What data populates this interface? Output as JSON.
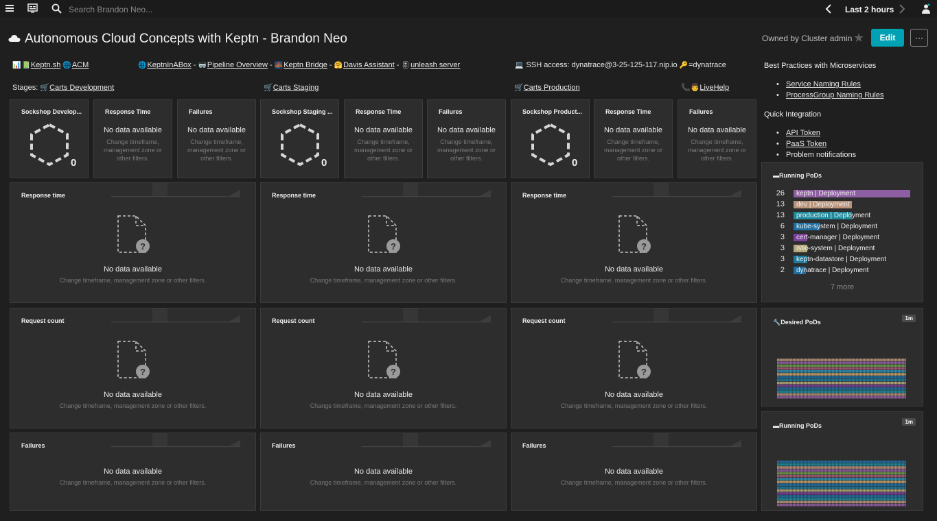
{
  "topbar": {
    "search_placeholder": "Search Brandon Neo...",
    "timeframe": "Last 2 hours"
  },
  "header": {
    "title": "Autonomous Cloud Concepts with Keptn - Brandon Neo",
    "owned_by": "Owned by Cluster admin",
    "edit_label": "Edit",
    "more_label": "···"
  },
  "links": {
    "keptn_sh": "Keptn.sh",
    "acm": "ACM",
    "keptninabox": "KeptnInABox",
    "pipeline_overview": "Pipeline Overview",
    "keptn_bridge": "Keptn Bridge",
    "davis_assistant": "Davis Assistant",
    "unleash_server": "unleash server",
    "ssh_access": "SSH access: dynatrace@3-25-125-117.nip.io",
    "ssh_pass": "=dynatrace",
    "dash": "-"
  },
  "stages": {
    "label": "Stages:",
    "dev": "Carts Development",
    "staging": "Carts Staging",
    "prod": "Carts Production",
    "livehelp": "LiveHelp"
  },
  "right_panel": {
    "bp_title": "Best Practices with Microservices",
    "bp_items": [
      "Service Naming Rules",
      "ProcessGroup Naming Rules"
    ],
    "qi_title": "Quick Integration",
    "qi_items": [
      "API Token",
      "PaaS Token",
      "Problem notifications"
    ]
  },
  "small_tiles": {
    "dev_app": "Sockshop Develop...",
    "staging_app": "Sockshop Staging ...",
    "prod_app": "Sockshop Product...",
    "response_time": "Response Time",
    "failures": "Failures",
    "no_data": "No data available",
    "no_data_sub": "Change timeframe, management zone or other filters.",
    "hex_count": "0"
  },
  "big_tiles": {
    "response_time": "Response time",
    "request_count": "Request count",
    "failures": "Failures",
    "no_data": "No data available",
    "no_data_sub": "Change timeframe, management zone or other filters."
  },
  "running_pods": {
    "title": "Running PoDs",
    "rows": [
      {
        "count": "26",
        "label": "keptn | Deployment",
        "color": "#8e5ea2",
        "value": 26
      },
      {
        "count": "13",
        "label": "dev | Deployment",
        "color": "#b9927a",
        "value": 13
      },
      {
        "count": "13",
        "label": "production | Deployment",
        "color": "#1c8a9c",
        "value": 13
      },
      {
        "count": "6",
        "label": "kube-system | Deployment",
        "color": "#1f6fa3",
        "value": 6
      },
      {
        "count": "3",
        "label": "cert-manager | Deployment",
        "color": "#7a3f98",
        "value": 3
      },
      {
        "count": "3",
        "label": "istio-system | Deployment",
        "color": "#b5a878",
        "value": 3
      },
      {
        "count": "3",
        "label": "keptn-datastore | Deployment",
        "color": "#1c7a9c",
        "value": 3
      },
      {
        "count": "2",
        "label": "dynatrace | Deployment",
        "color": "#1f6fa3",
        "value": 2
      }
    ],
    "more": "7 more"
  },
  "desired_pods": {
    "title": "Desired PoDs",
    "badge": "1m"
  },
  "running_pods_chart": {
    "title": "Running PoDs",
    "badge": "1m"
  }
}
